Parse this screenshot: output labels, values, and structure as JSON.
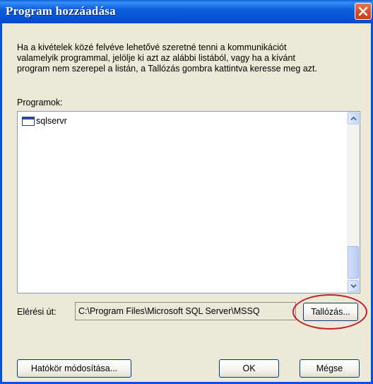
{
  "window": {
    "title": "Program hozzáadása"
  },
  "description": "Ha a kivételek közé felvéve lehetővé szeretné tenni a kommunikációt\nvalamelyik programmal, jelölje ki azt az alábbi listából, vagy ha a kívánt\nprogram nem szerepel a listán, a Tallózás gombra kattintva keresse meg azt.",
  "programs": {
    "label": "Programok:",
    "items": [
      {
        "label": "sqlservr",
        "icon": "application-window-icon"
      }
    ]
  },
  "path": {
    "label": "Elérési út:",
    "value": "C:\\Program Files\\Microsoft SQL Server\\MSSQ"
  },
  "buttons": {
    "browse": "Tallózás...",
    "change_scope": "Hatókör módosítása...",
    "ok": "OK",
    "cancel": "Mégse"
  },
  "colors": {
    "titlebar": "#0453d4",
    "close": "#d8512b",
    "annotation_oval": "#c81e2a"
  }
}
